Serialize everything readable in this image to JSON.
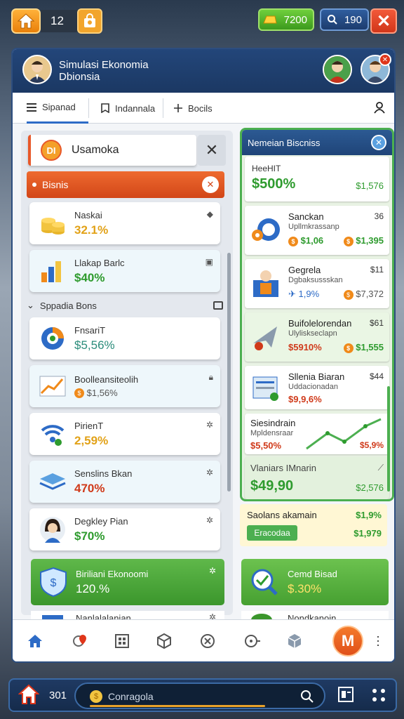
{
  "top": {
    "level": "12",
    "gold": "7200",
    "gems": "190",
    "close": "✕"
  },
  "header": {
    "title_line1": "Simulasi Ekonomia",
    "title_line2": "Dbionsia"
  },
  "tabs": [
    {
      "label": "Sipanad"
    },
    {
      "label": "Indannala"
    },
    {
      "label": "Bocils"
    }
  ],
  "search": {
    "label": "Usamoka",
    "close": "✕"
  },
  "bisnis_bar": {
    "label": "Bisnis",
    "close": "✕"
  },
  "left_cards": [
    {
      "name": "Naskai",
      "value": "32.1%",
      "color": "#e2a218"
    },
    {
      "name": "Llakap Barlc",
      "value": "$40%",
      "color": "#2e9b2e"
    }
  ],
  "section": {
    "label": "Sppadia Bons"
  },
  "left_cards2": [
    {
      "name": "FnsariT",
      "value": "$5,56%",
      "color": "#2a8c7a"
    },
    {
      "name": "Boolleansiteolih",
      "value": "$1,56%",
      "color": "#555"
    },
    {
      "name": "PirienT",
      "value": "2,59%",
      "color": "#e2a218"
    },
    {
      "name": "Senslins Bkan",
      "value": "470%",
      "color": "#d03a1a"
    },
    {
      "name": "Degkley Pian",
      "value": "$70%",
      "color": "#2e9b2e"
    }
  ],
  "promo_left": {
    "name": "Biriliani Ekonoomi",
    "value": "120.%"
  },
  "last_left": {
    "name": "Nanlalalanian"
  },
  "right": {
    "title": "Nemeian Biscniss",
    "close": "✕",
    "c1": {
      "name": "HeeHIT",
      "value": "$500%",
      "side": "$1,576"
    },
    "c2": {
      "name": "Sanckan",
      "sub": "Upllmkrassanp",
      "num": "36",
      "v1": "$1,06",
      "v2": "$1,395"
    },
    "c3": {
      "name": "Gegrela",
      "sub": "Dgbaksussskan",
      "num": "$11",
      "v1": "1,9%",
      "v2": "$7,372"
    },
    "c4": {
      "name": "Buifolelorendan",
      "sub": "Ulyliskseclapn",
      "num": "$61",
      "v1": "$5910%",
      "v2": "$1,555"
    },
    "c5": {
      "name": "Sllenia Biaran",
      "sub": "Uddacionadan",
      "num": "$44",
      "v1": "$9,9,6%"
    },
    "c6": {
      "name": "Siesindrain",
      "sub": "Mpldensraar",
      "v1": "$5,50%",
      "v2": "$5,9%"
    },
    "c7": {
      "name": "Vlaniars IMnarin",
      "value": "$49,90",
      "side": "$2,576"
    }
  },
  "outside_right": {
    "name": "Saolans akamain",
    "btn": "Eracodaa",
    "v1": "$1,9%",
    "v2": "$1,979"
  },
  "promo_right": {
    "name": "Cemd Bisad",
    "value": "$.30%"
  },
  "last_right": {
    "name": "Nondkanoin"
  },
  "bottom_nav": {
    "m_label": "M"
  },
  "bottom_bar": {
    "count": "301",
    "search_placeholder": "Conragola"
  }
}
